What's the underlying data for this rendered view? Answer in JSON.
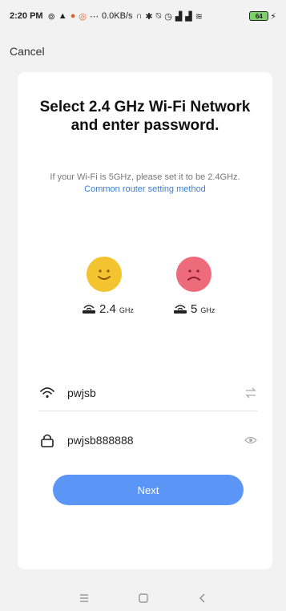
{
  "status_bar": {
    "time": "2:20 PM",
    "speed": "0.0KB/s",
    "battery": "64"
  },
  "header": {
    "cancel_label": "Cancel"
  },
  "card": {
    "title": "Select 2.4 GHz Wi-Fi Network and enter password.",
    "hint_text": "If your Wi-Fi is 5GHz, please set it to be 2.4GHz.",
    "hint_link": "Common router setting method",
    "bands": [
      {
        "value": "2.4",
        "unit": "GHz",
        "mood": "happy"
      },
      {
        "value": "5",
        "unit": "GHz",
        "mood": "sad"
      }
    ],
    "ssid_value": "pwjsb",
    "password_value": "pwjsb888888",
    "next_label": "Next"
  },
  "colors": {
    "accent": "#5b95f5",
    "link": "#3b7fd6",
    "happy_face": "#f4c430",
    "sad_face": "#ee6b7c"
  }
}
